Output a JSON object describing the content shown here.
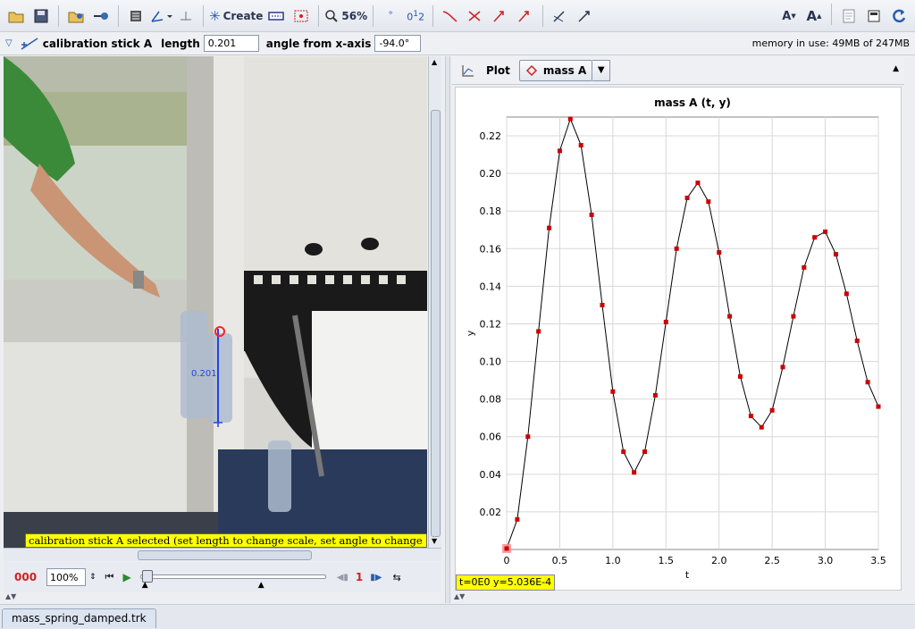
{
  "toolbar": {
    "create_label": "Create",
    "zoom_label": "56%"
  },
  "calibration": {
    "name": "calibration stick A",
    "length_label": "length",
    "length_value": "0.201",
    "angle_label": "angle from x-axis",
    "angle_value": "-94.0°"
  },
  "memory_text": "memory in use: 49MB of 247MB",
  "video": {
    "status_text": "calibration stick A selected (set length to change scale, set angle to change tilt)",
    "stick_label": "0.201"
  },
  "player": {
    "frame_counter": "000",
    "rate_value": "100%",
    "step_value": "1"
  },
  "plot": {
    "view_label": "Plot",
    "track_label": "mass A",
    "readout": "t=0E0  y=5.036E-4"
  },
  "file_tab": "mass_spring_damped.trk",
  "chart_data": {
    "type": "scatter",
    "title": "mass A (t, y)",
    "xlabel": "t",
    "ylabel": "y",
    "xlim": [
      0,
      3.5
    ],
    "ylim": [
      0,
      0.23
    ],
    "xticks": [
      "0",
      "0.5",
      "1.0",
      "1.5",
      "2.0",
      "2.5",
      "3.0",
      "3.5"
    ],
    "yticks": [
      "0.02",
      "0.04",
      "0.06",
      "0.08",
      "0.10",
      "0.12",
      "0.14",
      "0.16",
      "0.18",
      "0.20",
      "0.22"
    ],
    "grid": true,
    "line": true,
    "point_color": "#cc0000",
    "series": [
      {
        "x": [
          0,
          0.1,
          0.2,
          0.3,
          0.4,
          0.5,
          0.6,
          0.7,
          0.8,
          0.9,
          1.0,
          1.1,
          1.2,
          1.3,
          1.4,
          1.5,
          1.6,
          1.7,
          1.8,
          1.9,
          2.0,
          2.1,
          2.2,
          2.3,
          2.4,
          2.5,
          2.6,
          2.7,
          2.8,
          2.9,
          3.0,
          3.1,
          3.2,
          3.3,
          3.4,
          3.5
        ],
        "y": [
          0.0005,
          0.016,
          0.06,
          0.116,
          0.171,
          0.212,
          0.229,
          0.215,
          0.178,
          0.13,
          0.084,
          0.052,
          0.041,
          0.052,
          0.082,
          0.121,
          0.16,
          0.187,
          0.195,
          0.185,
          0.158,
          0.124,
          0.092,
          0.071,
          0.065,
          0.074,
          0.097,
          0.124,
          0.15,
          0.166,
          0.169,
          0.157,
          0.136,
          0.111,
          0.089,
          0.076
        ]
      }
    ]
  }
}
